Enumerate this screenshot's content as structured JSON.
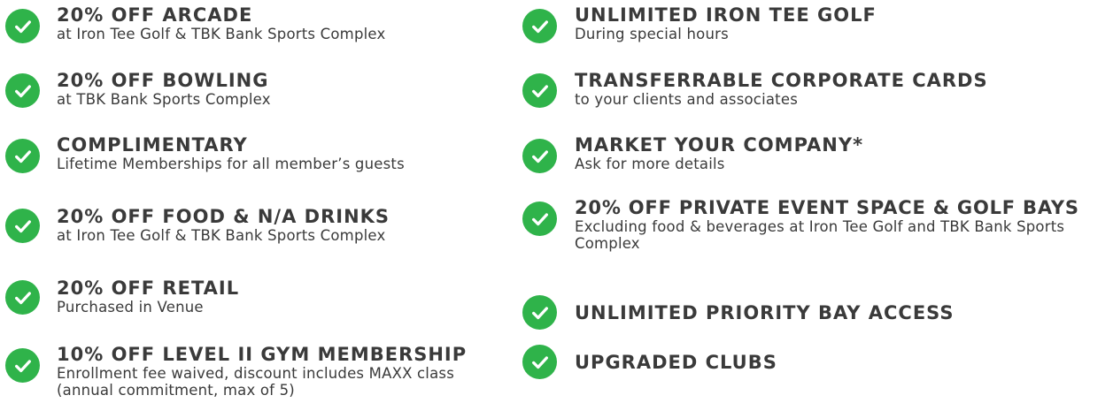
{
  "accent_color": "#2fb34a",
  "icon": "check-circle-icon",
  "left_column": [
    {
      "title": "20% OFF ARCADE",
      "subtitle": "at Iron Tee Golf & TBK Bank Sports Complex"
    },
    {
      "title": "20% OFF BOWLING",
      "subtitle": "at TBK Bank Sports Complex"
    },
    {
      "title": "COMPLIMENTARY",
      "subtitle": "Lifetime Memberships for all member’s guests"
    },
    {
      "title": "20% OFF FOOD & N/A DRINKS",
      "subtitle": "at Iron Tee Golf & TBK Bank Sports Complex"
    },
    {
      "title": "20% OFF RETAIL",
      "subtitle": "Purchased in Venue"
    },
    {
      "title": "10% OFF LEVEL II GYM MEMBERSHIP",
      "subtitle": "Enrollment fee waived, discount includes MAXX class (annual commitment, max of 5)"
    }
  ],
  "right_column": [
    {
      "title": "UNLIMITED IRON TEE GOLF",
      "subtitle": "During special hours"
    },
    {
      "title": "TRANSFERRABLE CORPORATE CARDS",
      "subtitle": "to your clients and associates"
    },
    {
      "title": "MARKET YOUR COMPANY*",
      "subtitle": "Ask for more details"
    },
    {
      "title": "20% OFF PRIVATE EVENT SPACE & GOLF BAYS",
      "subtitle": "Excluding food & beverages at Iron Tee Golf and TBK Bank Sports Complex"
    },
    {
      "title": "UNLIMITED PRIORITY BAY ACCESS"
    },
    {
      "title": "UPGRADED CLUBS"
    }
  ]
}
